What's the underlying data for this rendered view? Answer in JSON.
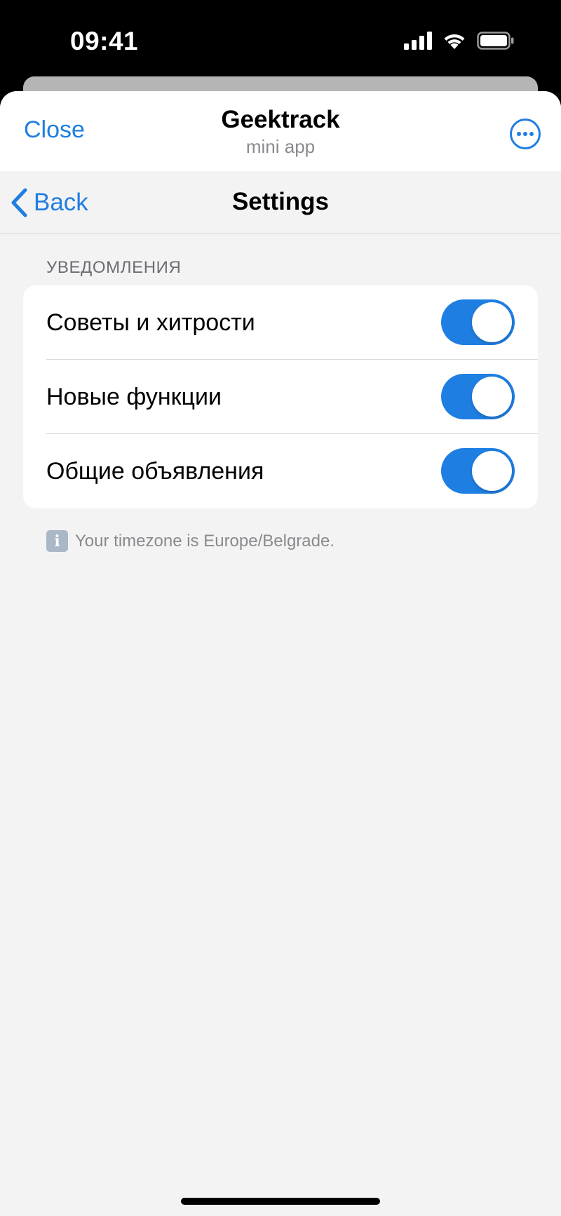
{
  "status_bar": {
    "time": "09:41"
  },
  "app_header": {
    "close_label": "Close",
    "title": "Geektrack",
    "subtitle": "mini app",
    "more_icon": "ellipsis-circle-icon"
  },
  "nav": {
    "back_label": "Back",
    "title": "Settings"
  },
  "notifications": {
    "section_title": "УВЕДОМЛЕНИЯ",
    "items": [
      {
        "label": "Советы и хитрости",
        "enabled": true
      },
      {
        "label": "Новые функции",
        "enabled": true
      },
      {
        "label": "Общие объявления",
        "enabled": true
      }
    ]
  },
  "footer": {
    "icon_glyph": "i",
    "text": "Your timezone is Europe/Belgrade."
  },
  "colors": {
    "accent": "#1f7ee2",
    "background": "#f3f3f4",
    "card": "#ffffff",
    "secondary_text": "#8a8a8e"
  }
}
